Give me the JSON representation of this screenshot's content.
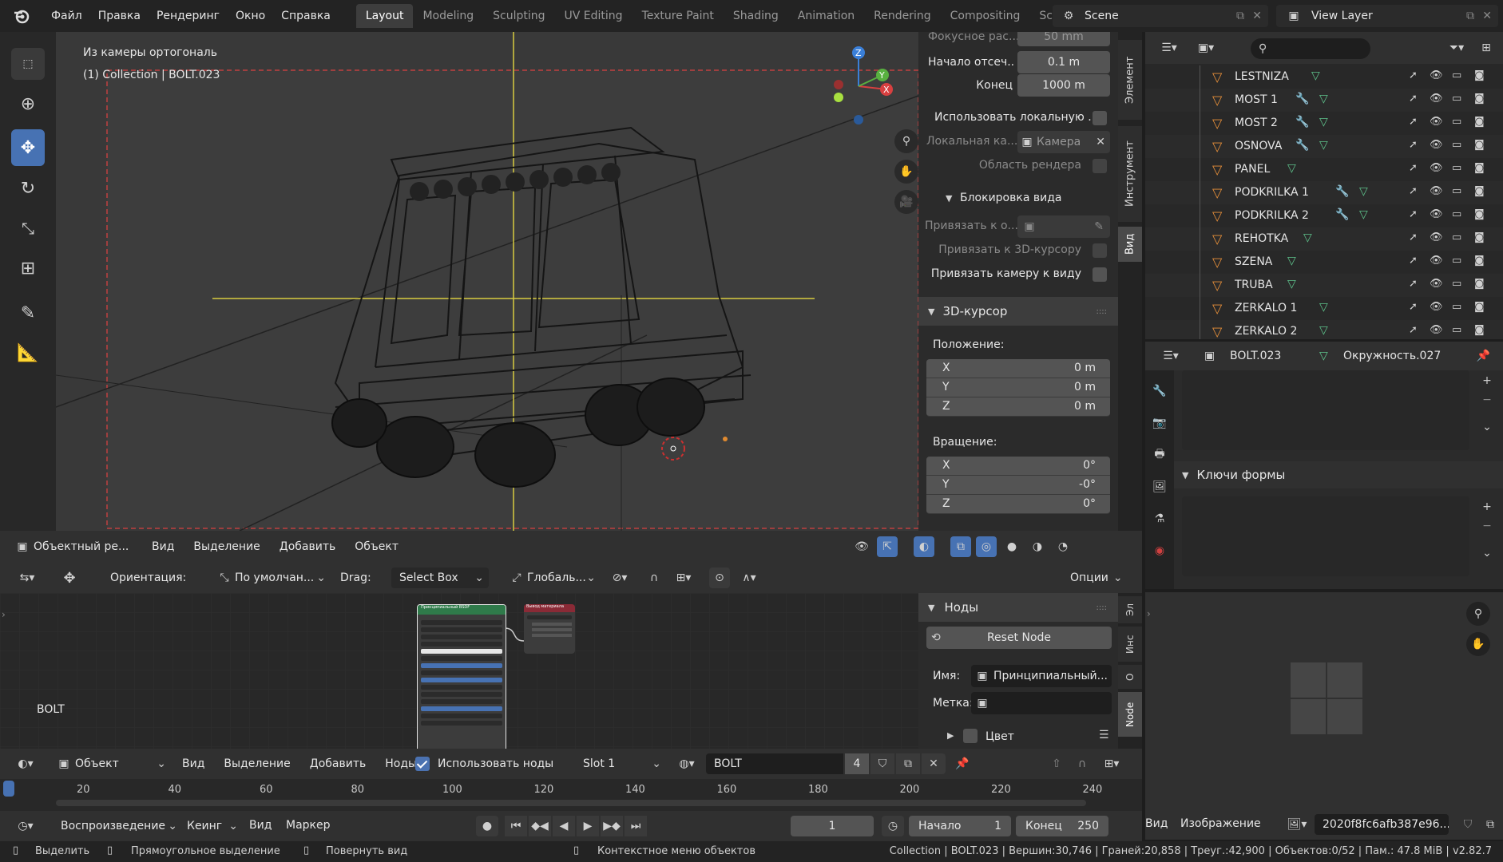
{
  "topbar": {
    "menus": [
      "Файл",
      "Правка",
      "Рендеринг",
      "Окно",
      "Справка"
    ],
    "workspaces": [
      "Layout",
      "Modeling",
      "Sculpting",
      "UV Editing",
      "Texture Paint",
      "Shading",
      "Animation",
      "Rendering",
      "Compositing",
      "Sc"
    ],
    "active_workspace": "Layout",
    "scene": "Scene",
    "view_layer": "View Layer"
  },
  "viewport": {
    "camera_label": "Из камеры ортогональ",
    "collection_label": "(1) Collection | BOLT.023",
    "header": {
      "mode": "Объектный ре...",
      "menus": [
        "Вид",
        "Выделение",
        "Добавить",
        "Объект"
      ]
    }
  },
  "npanel": {
    "tabs": [
      "Элемент",
      "Инструмент",
      "Вид"
    ],
    "focal_row": {
      "label": "Фокусное рас...",
      "value": "50 mm"
    },
    "clip_start": {
      "label": "Начало отсеч..",
      "value": "0.1 m"
    },
    "clip_end": {
      "label": "Конец",
      "value": "1000 m"
    },
    "use_local": "Использовать локальную ...",
    "local_camera": {
      "label": "Локальная ка...",
      "value": "Камера"
    },
    "render_region": "Область рендера",
    "view_lock_title": "Блокировка вида",
    "lock_to": "Привязать к о...",
    "lock_cursor": "Привязать к 3D-курсору",
    "lock_camera": "Привязать камеру к виду",
    "cursor_title": "3D-курсор",
    "position_label": "Положение:",
    "position": [
      {
        "axis": "X",
        "value": "0 m"
      },
      {
        "axis": "Y",
        "value": "0 m"
      },
      {
        "axis": "Z",
        "value": "0 m"
      }
    ],
    "rotation_label": "Вращение:",
    "rotation": [
      {
        "axis": "X",
        "value": "0°"
      },
      {
        "axis": "Y",
        "value": "-0°"
      },
      {
        "axis": "Z",
        "value": "0°"
      }
    ]
  },
  "outliner": {
    "items": [
      "LESTNIZA",
      "MOST 1",
      "MOST 2",
      "OSNOVA",
      "PANEL",
      "PODKRILKA 1",
      "PODKRILKA 2",
      "REHOTKA",
      "SZENA",
      "TRUBA",
      "ZERKALO 1",
      "ZERKALO 2"
    ]
  },
  "properties": {
    "object": "BOLT.023",
    "mesh": "Окружность.027",
    "shape_keys_title": "Ключи формы"
  },
  "tool_header": {
    "orientation_label": "Ориентация:",
    "orientation_value": "По умолчан...",
    "drag_label": "Drag:",
    "drag_value": "Select Box",
    "pivot": "Глобаль...",
    "options": "Опции"
  },
  "node_editor": {
    "object_label": "BOLT",
    "node1_title": "Принципиальный BSDF",
    "node2_title": "Вывод материала",
    "sidebar": {
      "tabs": [
        "Эл",
        "Инс",
        "О",
        "Node"
      ],
      "title": "Ноды",
      "reset": "Reset Node",
      "name_label": "Имя:",
      "name_value": "Принципиальный...",
      "label_label": "Метка:",
      "color": "Цвет"
    },
    "header": {
      "type": "Объект",
      "menus": [
        "Вид",
        "Выделение",
        "Добавить",
        "Ноды"
      ],
      "use_nodes": "Использовать ноды",
      "slot": "Slot 1",
      "material": "BOLT",
      "users": "4"
    }
  },
  "timeline": {
    "ticks": [
      "20",
      "40",
      "60",
      "80",
      "100",
      "120",
      "140",
      "160",
      "180",
      "200",
      "220",
      "240"
    ],
    "menus": [
      "Воспроизведение",
      "Кеинг",
      "Вид",
      "Маркер"
    ],
    "current_frame": "1",
    "start_label": "Начало",
    "start": "1",
    "end_label": "Конец",
    "end": "250"
  },
  "image_editor": {
    "menus": [
      "Вид",
      "Изображение"
    ],
    "image": "2020f8fc6afb387e96..."
  },
  "statusbar": {
    "select": "Выделить",
    "box_select": "Прямоугольное выделение",
    "rotate": "Повернуть вид",
    "context_menu": "Контекстное меню объектов",
    "stats": "Collection | BOLT.023 | Вершин:30,746 | Граней:20,858 | Треуг.:42,900 | Объектов:0/52 | Пам.: 47.8 MiB | v2.82.7"
  }
}
